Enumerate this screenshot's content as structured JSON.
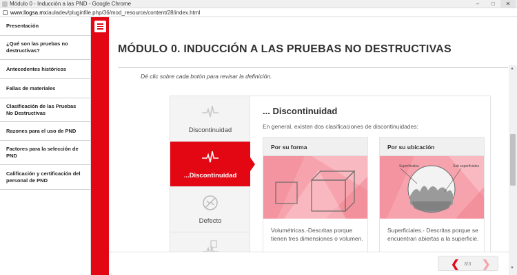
{
  "window": {
    "title": "Módulo 0 - Inducción a las PND - Google Chrome",
    "url_host": "www.llogsa.mx",
    "url_path": "/auladev/pluginfile.php/36/mod_resource/content/28/index.html",
    "controls": {
      "minimize": "–",
      "maximize": "□",
      "close": "✕"
    }
  },
  "sidebar": {
    "items": [
      {
        "label": "Presentación"
      },
      {
        "label": "¿Qué son las pruebas no destructivas?"
      },
      {
        "label": "Antecedentes históricos"
      },
      {
        "label": "Fallas de materiales"
      },
      {
        "label": "Clasificación de las Pruebas No Destructivas"
      },
      {
        "label": "Razones para el uso de PND"
      },
      {
        "label": "Factores para la selección de PND"
      },
      {
        "label": "Calificación y certificación del personal de PND"
      }
    ]
  },
  "main": {
    "title": "MÓDULO 0. INDUCCIÓN A LAS PRUEBAS NO DESTRUCTIVAS",
    "instruction": "Dé clic sobre cada botón para revisar la definición."
  },
  "widget": {
    "tabs": [
      {
        "label": "Discontinuidad",
        "icon": "pulse-icon"
      },
      {
        "label": "...Discontinuidad",
        "icon": "pulse-icon",
        "active": true
      },
      {
        "label": "Defecto",
        "icon": "broken-wrench-icon"
      },
      {
        "label": "",
        "icon": "document-pulse-icon"
      }
    ],
    "content": {
      "title": "... Discontinuidad",
      "description": "En general, existen dos clasificaciones de discontinuidades:",
      "cards": [
        {
          "heading": "Por su forma",
          "text": "Volumétricas.-Descritas porque tienen tres dimensiones o volumen."
        },
        {
          "heading": "Por su ubicación",
          "image_labels": {
            "left": "Superficiales",
            "right": "Sub superficiales"
          },
          "text": "Superficiales.- Descritas porque se encuentran abiertas a la superficie."
        }
      ]
    }
  },
  "pager": {
    "prev": "❮",
    "count": "3/3",
    "next": "❯"
  },
  "colors": {
    "accent": "#e30613",
    "pink_bg": "#f7a1ab"
  }
}
